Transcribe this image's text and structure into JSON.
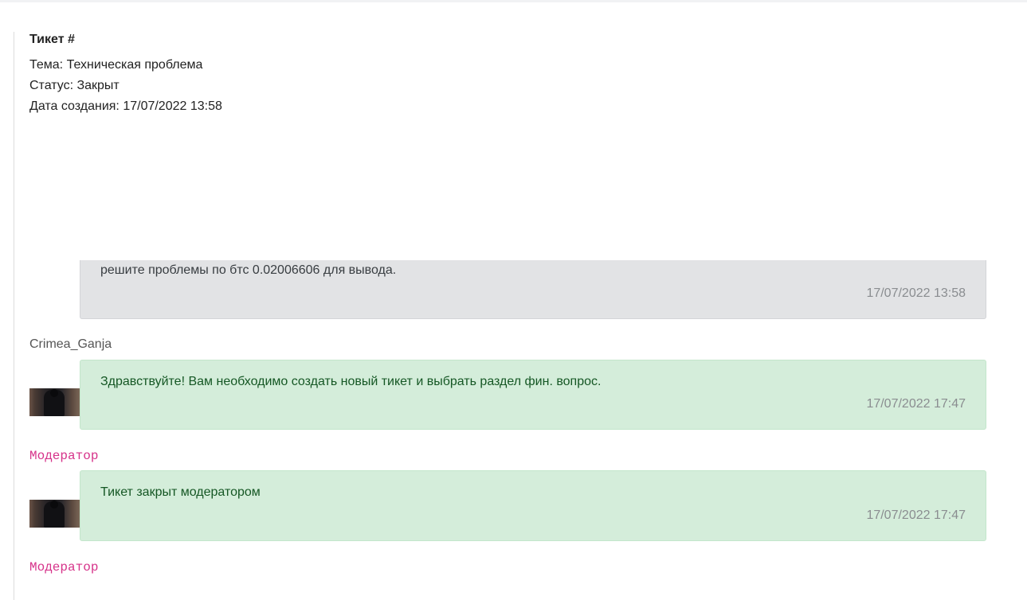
{
  "ticket": {
    "title": "Тикет #",
    "topic": "Тема: Техническая проблема",
    "status": "Статус: Закрыт",
    "created": "Дата создания: 17/07/2022 13:58"
  },
  "messages": [
    {
      "text": "решите проблемы по бтс 0.02006606 для вывода.",
      "time": "17/07/2022 13:58",
      "author": "Crimea_Ganja"
    },
    {
      "text": "Здравствуйте! Вам необходимо создать новый тикет и выбрать раздел фин. вопрос.",
      "time": "17/07/2022 17:47",
      "role": "Модератор"
    },
    {
      "text": "Тикет закрыт модератором",
      "time": "17/07/2022 17:47",
      "role": "Модератор"
    }
  ],
  "colors": {
    "user_bubble": "#e2e3e5",
    "mod_bubble": "#d4edda",
    "mod_text": "#155724",
    "role_text": "#d6338a"
  }
}
